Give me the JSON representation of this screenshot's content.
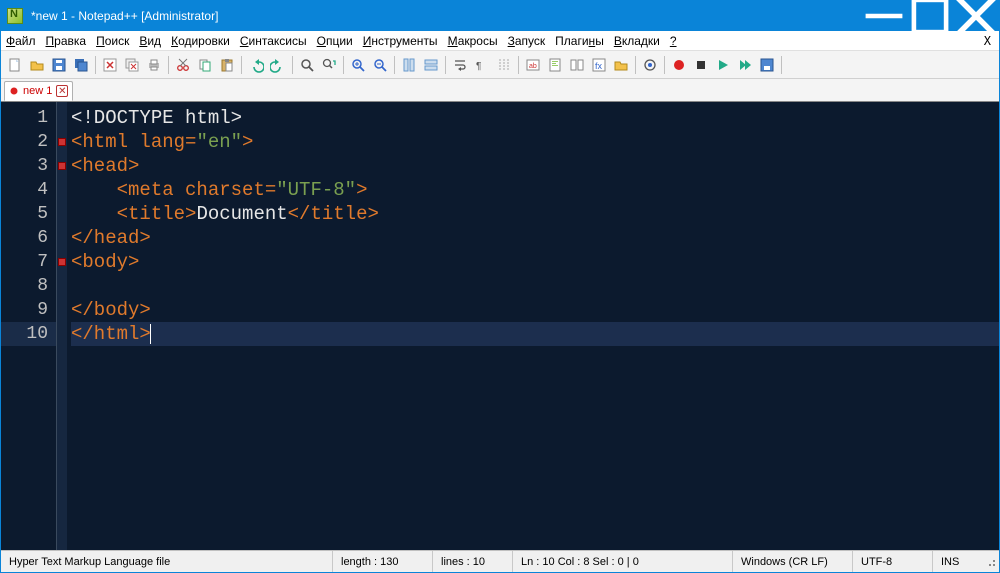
{
  "title": "*new 1 - Notepad++ [Administrator]",
  "menu": [
    "Файл",
    "Правка",
    "Поиск",
    "Вид",
    "Кодировки",
    "Синтаксисы",
    "Опции",
    "Инструменты",
    "Макросы",
    "Запуск",
    "Плагины",
    "Вкладки",
    "?"
  ],
  "menu_accel": [
    0,
    0,
    0,
    0,
    0,
    0,
    0,
    0,
    0,
    0,
    5,
    0,
    0
  ],
  "tab": {
    "label": "new 1"
  },
  "code": {
    "lines": [
      [
        [
          "txt",
          "<!DOCTYPE html>"
        ]
      ],
      [
        [
          "tag",
          "<html "
        ],
        [
          "attr",
          "lang="
        ],
        [
          "val",
          "\"en\""
        ],
        [
          "tag",
          ">"
        ]
      ],
      [
        [
          "tag",
          "<head>"
        ]
      ],
      [
        [
          "txt",
          "    "
        ],
        [
          "tag",
          "<meta "
        ],
        [
          "attr",
          "charset="
        ],
        [
          "val",
          "\"UTF-8\""
        ],
        [
          "tag",
          ">"
        ]
      ],
      [
        [
          "txt",
          "    "
        ],
        [
          "tag",
          "<title>"
        ],
        [
          "txt",
          "Document"
        ],
        [
          "tag",
          "</title>"
        ]
      ],
      [
        [
          "tag",
          "</head>"
        ]
      ],
      [
        [
          "tag",
          "<body>"
        ]
      ],
      [
        [
          "txt",
          ""
        ]
      ],
      [
        [
          "tag",
          "</body>"
        ]
      ],
      [
        [
          "tag",
          "</html>"
        ]
      ]
    ],
    "fold_markers_at": [
      2,
      3,
      7
    ],
    "current_line": 10
  },
  "status": {
    "filetype": "Hyper Text Markup Language file",
    "length": "length : 130",
    "lines": "lines : 10",
    "pos": "Ln : 10    Col : 8    Sel : 0 | 0",
    "eol": "Windows (CR LF)",
    "encoding": "UTF-8",
    "ins": "INS"
  },
  "toolbar_icons": [
    "new-file-icon",
    "open-icon",
    "save-icon",
    "save-all-icon",
    "close-icon",
    "close-all-icon",
    "print-icon",
    "cut-icon",
    "copy-icon",
    "paste-icon",
    "undo-icon",
    "redo-icon",
    "find-icon",
    "replace-icon",
    "zoom-in-icon",
    "zoom-out-icon",
    "sync-v-icon",
    "sync-h-icon",
    "wrap-icon",
    "show-all-icon",
    "indent-guide-icon",
    "lang-icon",
    "doc-map-icon",
    "doc-list-icon",
    "function-list-icon",
    "folder-icon",
    "monitor-icon",
    "record-icon",
    "stop-icon",
    "play-icon",
    "play-multi-icon",
    "save-macro-icon"
  ]
}
